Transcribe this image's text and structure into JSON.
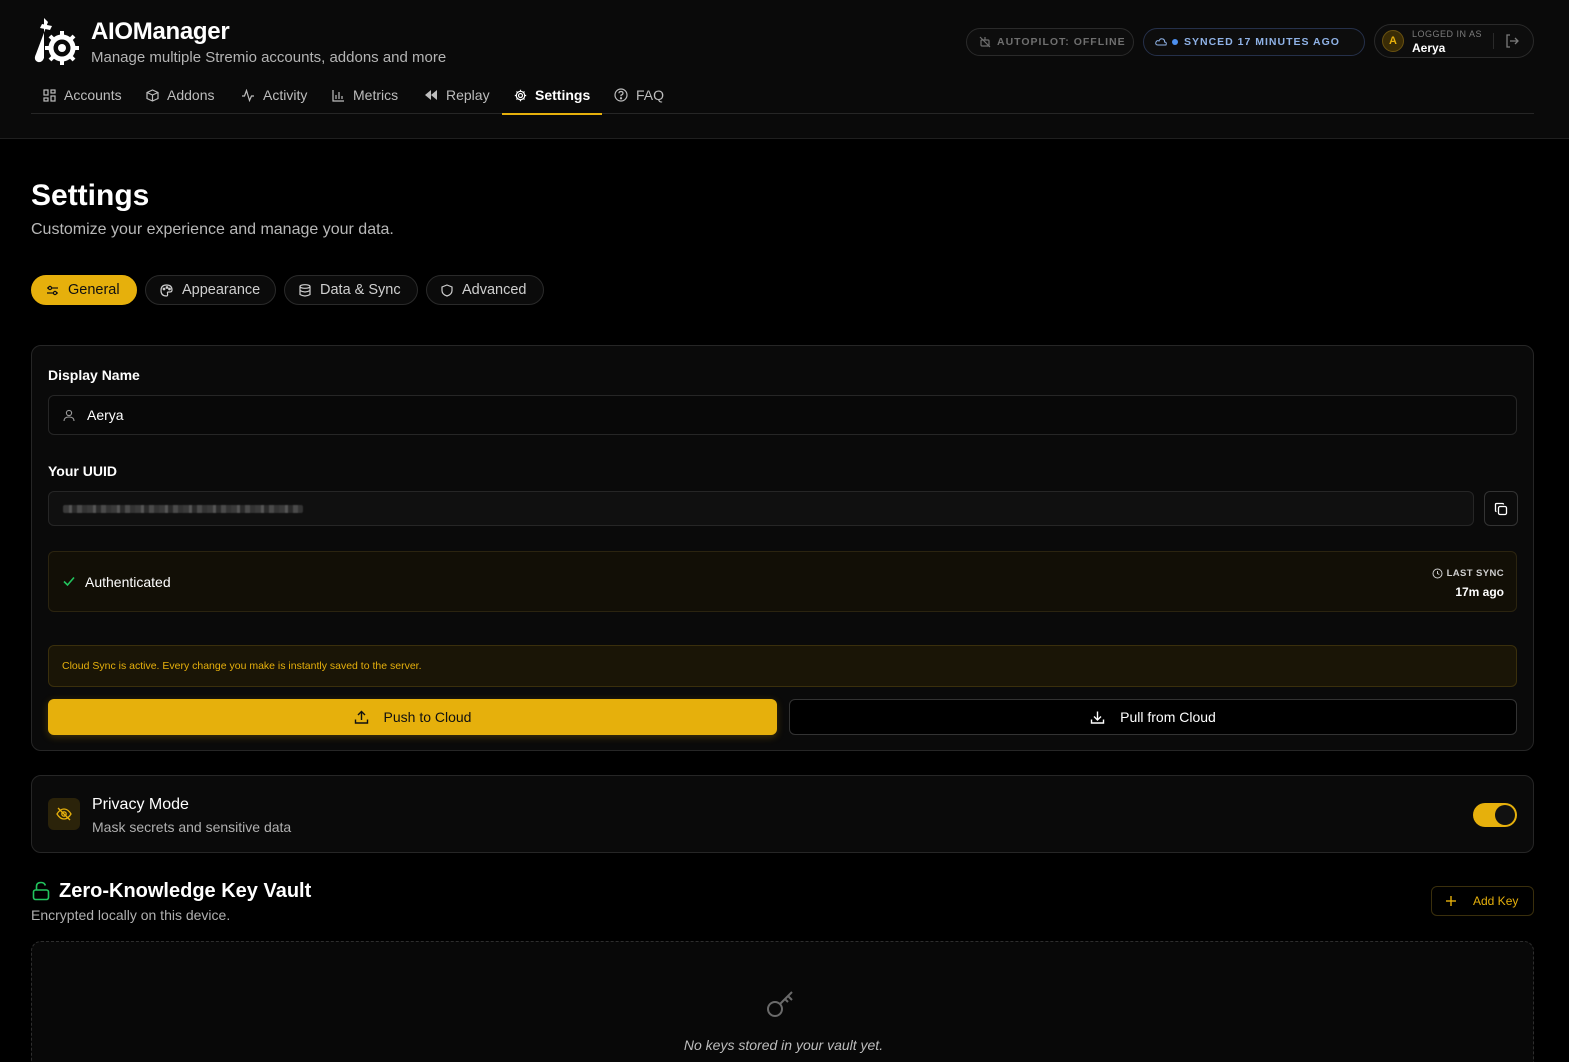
{
  "app": {
    "title": "AIOManager",
    "subtitle": "Manage multiple Stremio accounts, addons and more"
  },
  "status": {
    "autopilot": "AUTOPILOT: OFFLINE",
    "synced": "SYNCED 17 MINUTES AGO"
  },
  "user": {
    "avatar_letter": "A",
    "logged_in_label": "LOGGED IN AS",
    "name": "Aerya"
  },
  "nav": {
    "items": [
      {
        "label": "Accounts",
        "icon": "grid-icon"
      },
      {
        "label": "Addons",
        "icon": "package-icon"
      },
      {
        "label": "Activity",
        "icon": "activity-icon"
      },
      {
        "label": "Metrics",
        "icon": "bar-chart-icon"
      },
      {
        "label": "Replay",
        "icon": "rewind-icon"
      },
      {
        "label": "Settings",
        "icon": "gear-icon",
        "active": true
      },
      {
        "label": "FAQ",
        "icon": "help-circle-icon"
      }
    ]
  },
  "page": {
    "title": "Settings",
    "subtitle": "Customize your experience and manage your data."
  },
  "tabs": [
    {
      "label": "General",
      "icon": "sliders-icon",
      "active": true
    },
    {
      "label": "Appearance",
      "icon": "palette-icon"
    },
    {
      "label": "Data & Sync",
      "icon": "database-icon"
    },
    {
      "label": "Advanced",
      "icon": "shield-icon"
    }
  ],
  "general": {
    "display_name_label": "Display Name",
    "display_name_value": "Aerya",
    "uuid_label": "Your UUID",
    "auth_status": "Authenticated",
    "last_sync_label": "LAST SYNC",
    "last_sync_value": "17m ago",
    "cloud_notice": "Cloud Sync is active. Every change you make is instantly saved to the server.",
    "push_label": "Push to Cloud",
    "pull_label": "Pull from Cloud"
  },
  "privacy": {
    "title": "Privacy Mode",
    "subtitle": "Mask secrets and sensitive data",
    "enabled": true
  },
  "vault": {
    "title": "Zero-Knowledge Key Vault",
    "subtitle": "Encrypted locally on this device.",
    "add_label": "Add Key",
    "empty_text": "No keys stored in your vault yet."
  },
  "colors": {
    "accent": "#e6b00c",
    "background": "#000000",
    "success": "#22c55e",
    "sync_blue": "#4d90f0"
  }
}
